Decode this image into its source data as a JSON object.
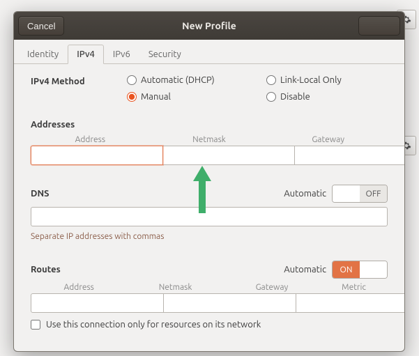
{
  "titlebar": {
    "cancel": "Cancel",
    "title": "New Profile"
  },
  "tabs": [
    "Identity",
    "IPv4",
    "IPv6",
    "Security"
  ],
  "active_tab": 1,
  "method": {
    "label": "IPv4 Method",
    "options": {
      "auto": "Automatic (DHCP)",
      "link": "Link-Local Only",
      "manual": "Manual",
      "disable": "Disable"
    },
    "selected": "manual"
  },
  "addresses": {
    "title": "Addresses",
    "cols": [
      "Address",
      "Netmask",
      "Gateway"
    ],
    "row": {
      "address": "",
      "netmask": "",
      "gateway": ""
    }
  },
  "dns": {
    "title": "DNS",
    "automatic_label": "Automatic",
    "automatic_on": false,
    "on_label": "ON",
    "off_label": "OFF",
    "value": "",
    "hint": "Separate IP addresses with commas"
  },
  "routes": {
    "title": "Routes",
    "automatic_label": "Automatic",
    "automatic_on": true,
    "on_label": "ON",
    "off_label": "OFF",
    "cols": [
      "Address",
      "Netmask",
      "Gateway",
      "Metric"
    ],
    "row": {
      "address": "",
      "netmask": "",
      "gateway": "",
      "metric": ""
    },
    "only_resources": "Use this connection only for resources on its network",
    "only_resources_checked": false
  }
}
